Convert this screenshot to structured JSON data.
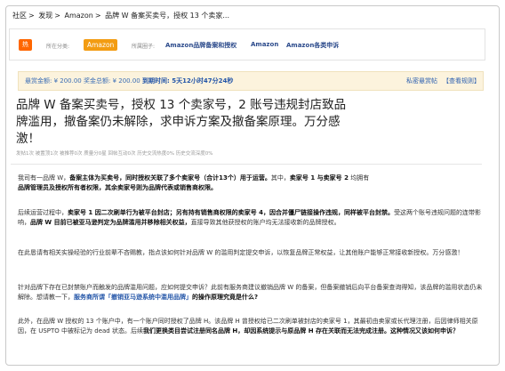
{
  "breadcrumb": [
    "社区",
    "发现",
    "Amazon",
    "品牌 W 备案买卖号，授权 13 个卖家..."
  ],
  "tags": {
    "hot": "热",
    "category_label": "所在分类:",
    "category": "Amazon",
    "circle_label": "所属圈子:",
    "circles": [
      "Amazon品牌备案和授权",
      "Amazon",
      "Amazon各类申诉"
    ]
  },
  "bounty": {
    "amount": "悬赏金额: ¥ 200.00",
    "total": "奖金总额: ¥ 200.00",
    "deadline": "到期时间: 5天12小时47分24秒",
    "right_link": "私密悬赏帖",
    "rules": "【查看规则】"
  },
  "post": {
    "title": "品牌 W 备案买卖号，授权 13 个卖家号，2 账号违规封店致品牌滥用，撤备案仍未解除，求申诉方案及撤备案原理。万分感激！",
    "meta": "发帖1次  被置顶1次  被推荐0次  质量分0星  回帖互动0次  历史交流热度0%  历史交流深度0%"
  },
  "paragraphs": {
    "p1_a": "我司有一品牌 W，",
    "p1_b": "备案主体为买卖号，",
    "p1_c": "同时授权关联了多个卖家号（合计13个）用于运营。",
    "p1_d": "其中，",
    "p1_e": "卖家号 1 与卖家号 2",
    "p1_f": " 均拥有",
    "p1_g": "品牌管理员及授权所有者权限，其余卖家号则为品牌代表或销售商权限。",
    "p2_a": "后续运营过程中，",
    "p2_b": "卖家号 1 因二次刷单行为被平台封店；另有持有销售商权限的卖家号 4，因合并僵尸链接操作违规，同样被平台封禁。",
    "p2_c": "受这两个账号违规问题的连带影响，",
    "p2_d": "品牌 W 目前已被亚马逊判定为品牌滥用并移除相关权益，",
    "p2_e": "直接导致其他获授权的账户均无法接收新的品牌授权。",
    "p3": "在此恳请有相关实操经验的行业前辈不吝赐教，指点该如何针对品牌 W 的滥用判定提交申诉，以恢复品牌正常权益，让其他账户能够正常接收新授权。万分感激！",
    "p4_a": "针对品牌下存在已封禁账户而触发的品牌滥用问题，应如何提交申诉？此前有服务商建议撤销品牌 W 的备案，但备案撤销后向平台备案查询得知，该品牌的滥用状态仍未解除。",
    "p4_b": "想请教一下，",
    "p4_c": "服务商所谓「撤销亚马逊系统中滥用品牌」",
    "p4_d": "的操作原理究竟是什么?",
    "p5_a": "此外，在品牌 W 授权的 13 个账户中，有一个账户同时授权了品牌 H。该品牌 H 曾授权给已二次刷单被封店的卖家号 1，其最初由卖家或长代理注册，后因律师相关原因，在 USPTO 中被标记为 dead 状态。后续",
    "p5_b": "我们更换类目尝试注册同名品牌 H，却因系统提示与原品牌 H 存在关联而无法完成注册。这种情况又该如何申诉？"
  }
}
